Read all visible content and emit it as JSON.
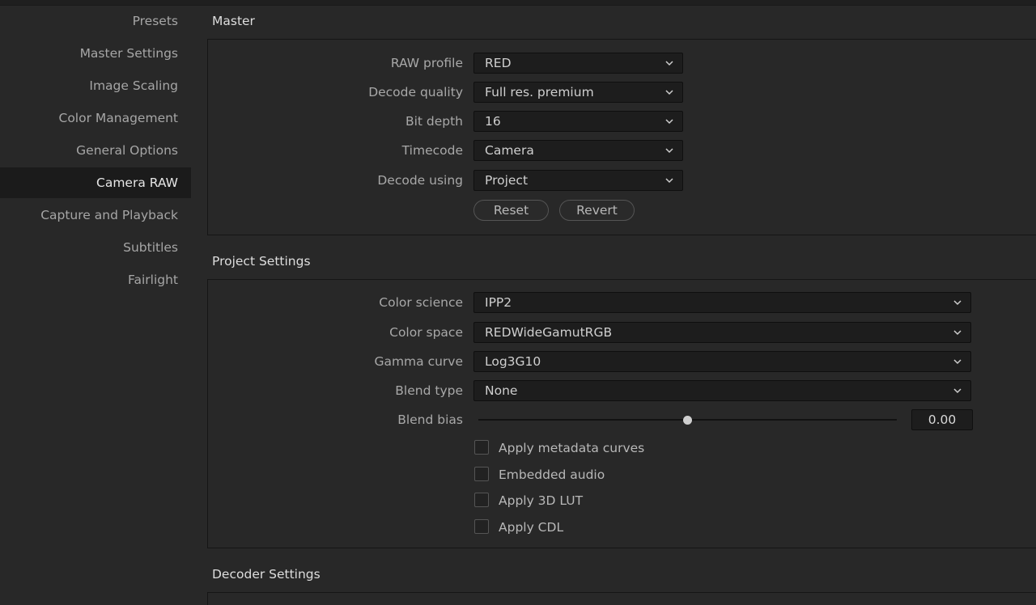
{
  "sidebar": {
    "items": [
      {
        "label": "Presets"
      },
      {
        "label": "Master Settings"
      },
      {
        "label": "Image Scaling"
      },
      {
        "label": "Color Management"
      },
      {
        "label": "General Options"
      },
      {
        "label": "Camera RAW",
        "active": true
      },
      {
        "label": "Capture and Playback"
      },
      {
        "label": "Subtitles"
      },
      {
        "label": "Fairlight"
      }
    ]
  },
  "master": {
    "title": "Master",
    "raw_profile": {
      "label": "RAW profile",
      "value": "RED"
    },
    "decode_quality": {
      "label": "Decode quality",
      "value": "Full res. premium"
    },
    "bit_depth": {
      "label": "Bit depth",
      "value": "16"
    },
    "timecode": {
      "label": "Timecode",
      "value": "Camera"
    },
    "decode_using": {
      "label": "Decode using",
      "value": "Project"
    },
    "reset_label": "Reset",
    "revert_label": "Revert"
  },
  "project": {
    "title": "Project Settings",
    "color_science": {
      "label": "Color science",
      "value": "IPP2"
    },
    "color_space": {
      "label": "Color space",
      "value": "REDWideGamutRGB"
    },
    "gamma_curve": {
      "label": "Gamma curve",
      "value": "Log3G10"
    },
    "blend_type": {
      "label": "Blend type",
      "value": "None"
    },
    "blend_bias": {
      "label": "Blend bias",
      "value": "0.00",
      "slider_fraction": 0.5
    },
    "checkboxes": [
      {
        "label": "Apply metadata curves",
        "checked": false
      },
      {
        "label": "Embedded audio",
        "checked": false
      },
      {
        "label": "Apply 3D LUT",
        "checked": false
      },
      {
        "label": "Apply CDL",
        "checked": false
      }
    ]
  },
  "decoder": {
    "title": "Decoder Settings"
  },
  "icons": {
    "dropdown": "chevron-down-icon"
  },
  "colors": {
    "background": "#282828",
    "sidebar_active": "#1b1b1b",
    "field": "#1d1d1d"
  }
}
